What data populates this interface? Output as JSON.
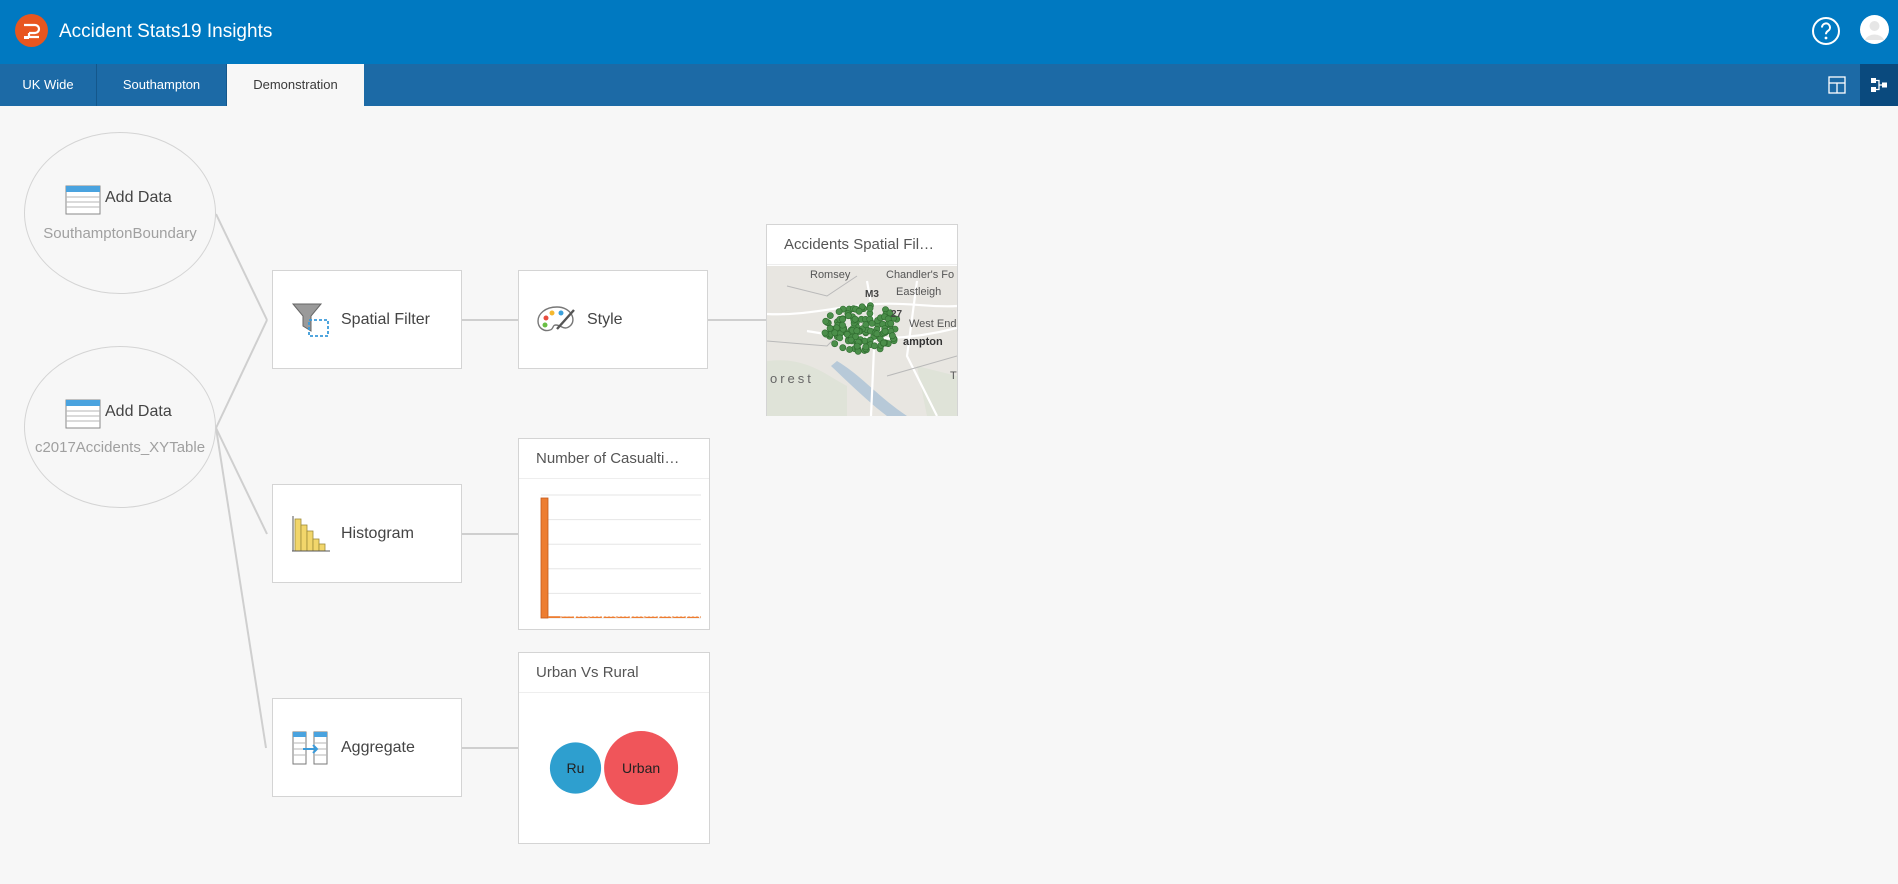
{
  "app": {
    "title": "Accident Stats19 Insights",
    "logo_icon": "insights-logo-icon",
    "brand_color": "#0079c1",
    "logo_color": "#e8561f"
  },
  "tabs": [
    {
      "label": "UK Wide",
      "active": false
    },
    {
      "label": "Southampton",
      "active": false
    },
    {
      "label": "Demonstration",
      "active": true
    }
  ],
  "toolbar": {
    "page_view_icon": "page-view-icon",
    "analysis_view_icon": "analysis-view-icon",
    "analysis_view_active": true
  },
  "workflow": {
    "data_nodes": [
      {
        "label": "Add Data",
        "dataset": "SouthamptonBoundary",
        "icon": "table-icon"
      },
      {
        "label": "Add Data",
        "dataset": "c2017Accidents_XYTable",
        "icon": "table-icon"
      }
    ],
    "operations": [
      {
        "label": "Spatial Filter",
        "icon": "spatial-filter-icon"
      },
      {
        "label": "Style",
        "icon": "palette-icon"
      },
      {
        "label": "Histogram",
        "icon": "histogram-icon"
      },
      {
        "label": "Aggregate",
        "icon": "aggregate-icon"
      }
    ],
    "results": [
      {
        "title": "Accidents Spatial Fil…",
        "type": "map",
        "map_labels": [
          "Romsey",
          "Chandler's Fo",
          "Eastleigh",
          "M3",
          "27",
          "West End",
          "ampton",
          "orest",
          "T"
        ]
      },
      {
        "title": "Number of Casualti…",
        "type": "histogram"
      },
      {
        "title": "Urban Vs Rural",
        "type": "bubble"
      }
    ]
  },
  "chart_data": [
    {
      "type": "bar",
      "title": "Number of Casualti…",
      "bars": 12,
      "values": [
        1,
        0.015,
        0.012,
        0.01,
        0.008,
        0.007,
        0.006,
        0.005,
        0.004,
        0.003,
        0.003,
        0.002
      ],
      "color": "#ed7d31"
    },
    {
      "type": "bubble",
      "title": "Urban Vs Rural",
      "categories": [
        "Ru",
        "Urban"
      ],
      "values": [
        0.48,
        1.0
      ],
      "colors": [
        "#2e9fcf",
        "#f0555a"
      ]
    }
  ]
}
